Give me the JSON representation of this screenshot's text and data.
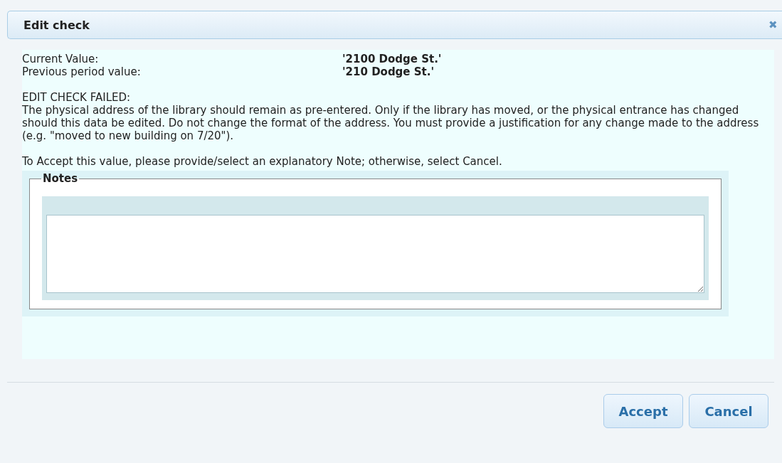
{
  "dialog": {
    "title": "Edit check",
    "close": "✖"
  },
  "values": [
    {
      "label": "Current Value:",
      "value": "'2100 Dodge St.'"
    },
    {
      "label": "Previous period value:",
      "value": "'210 Dodge St.'"
    }
  ],
  "heading": "EDIT CHECK FAILED:",
  "message": "The physical address of the library should remain as pre-entered. Only if the library has moved, or the physical entrance has changed should this data be edited. Do not change the format of the address. You must provide a justification for any change made to the address (e.g. \"moved to new building on 7/20\").",
  "instruction": "To Accept this value, please provide/select an explanatory Note; otherwise, select Cancel.",
  "notes": {
    "legend": "Notes"
  },
  "buttons": [
    "Accept",
    "Cancel"
  ]
}
